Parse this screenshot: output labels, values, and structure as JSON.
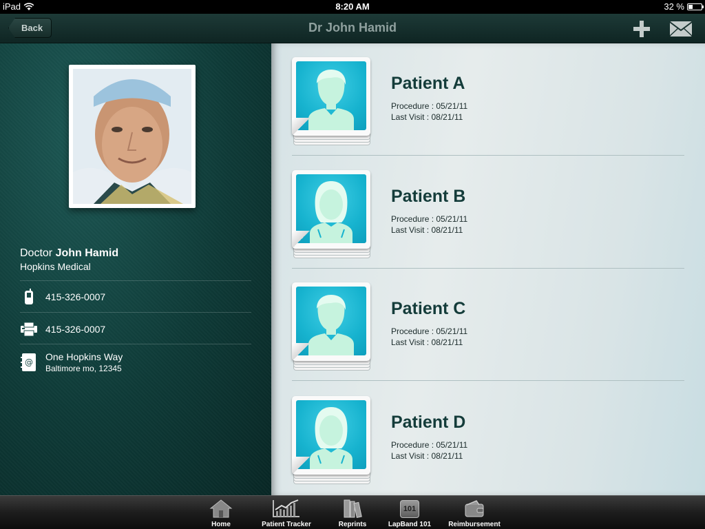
{
  "status_bar": {
    "carrier": "iPad",
    "time": "8:20 AM",
    "battery": "32 %",
    "battery_level": 0.32
  },
  "nav": {
    "back_label": "Back",
    "title": "Dr John Hamid",
    "add_icon": "plus-icon",
    "mail_icon": "mail-icon"
  },
  "doctor": {
    "prefix": "Doctor",
    "name": "John Hamid",
    "organization": "Hopkins Medical",
    "mobile": "415-326-0007",
    "fax": "415-326-0007",
    "address_line1": "One Hopkins Way",
    "address_line2": "Baltimore mo, 12345"
  },
  "patients": [
    {
      "name": "Patient A",
      "procedure": "Procedure : 05/21/11",
      "last_visit": "Last Visit : 08/21/11",
      "avatar": "male-avatar-icon"
    },
    {
      "name": "Patient B",
      "procedure": "Procedure : 05/21/11",
      "last_visit": "Last Visit : 08/21/11",
      "avatar": "female-avatar-icon"
    },
    {
      "name": "Patient C",
      "procedure": "Procedure : 05/21/11",
      "last_visit": "Last Visit : 08/21/11",
      "avatar": "male-avatar-icon"
    },
    {
      "name": "Patient D",
      "procedure": "Procedure : 05/21/11",
      "last_visit": "Last Visit : 08/21/11",
      "avatar": "female-avatar-icon"
    }
  ],
  "tabs": [
    {
      "label": "Home",
      "icon": "home-icon"
    },
    {
      "label": "Patient Tracker",
      "icon": "chart-icon"
    },
    {
      "label": "Reprints",
      "icon": "books-icon"
    },
    {
      "label": "LapBand 101",
      "icon": "lapband-101-icon",
      "icon_text": "101"
    },
    {
      "label": "Reimbursement",
      "icon": "wallet-icon"
    }
  ],
  "colors": {
    "accent": "#143c3a",
    "avatar_bg": "#17b3cf",
    "avatar_fg": "#c6f3de",
    "left_panel": "#0e3a37"
  }
}
